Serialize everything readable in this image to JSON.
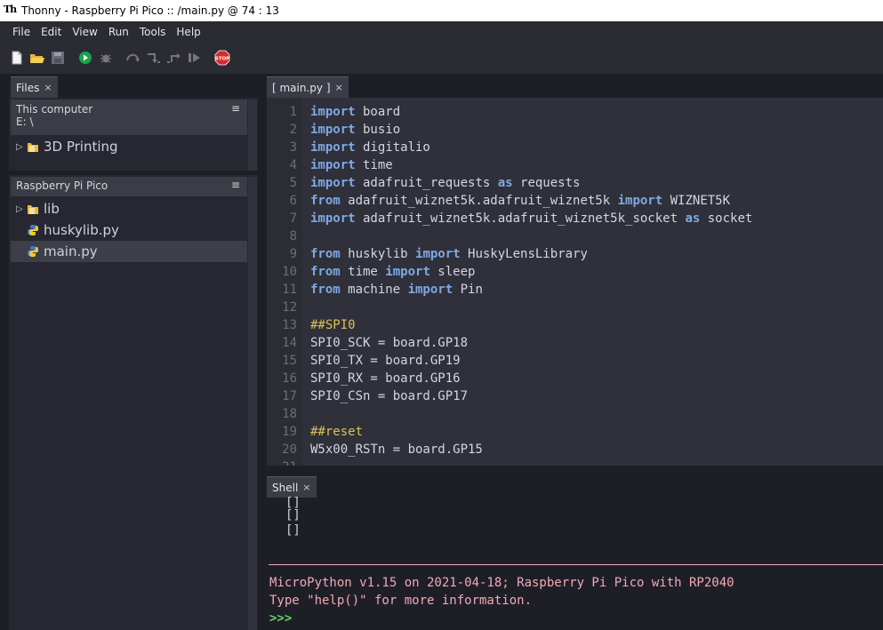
{
  "window": {
    "title": "Thonny  -  Raspberry Pi Pico :: /main.py  @  74 : 13"
  },
  "menu": [
    "File",
    "Edit",
    "View",
    "Run",
    "Tools",
    "Help"
  ],
  "toolbar": {
    "icons": [
      "new-file-icon",
      "open-folder-icon",
      "save-icon",
      "run-icon",
      "debug-icon",
      "step-over-icon",
      "step-into-icon",
      "step-out-icon",
      "resume-icon",
      "stop-icon"
    ],
    "stop_label": "STOP"
  },
  "files_panel": {
    "tab_label": "Files",
    "close": "×",
    "this_computer": {
      "label": "This computer",
      "path": "E: \\",
      "menu": "≡"
    },
    "local_items": [
      {
        "name": "3D Printing",
        "type": "folder"
      }
    ],
    "pico": {
      "label": "Raspberry Pi Pico",
      "menu": "≡",
      "items": [
        {
          "name": "lib",
          "type": "folder"
        },
        {
          "name": "huskylib.py",
          "type": "python"
        },
        {
          "name": "main.py",
          "type": "python",
          "selected": true
        }
      ]
    }
  },
  "editor": {
    "tab_label": "[ main.py ]",
    "close": "×",
    "lines": [
      [
        [
          "kw",
          "import"
        ],
        [
          "t",
          " board"
        ]
      ],
      [
        [
          "kw",
          "import"
        ],
        [
          "t",
          " busio"
        ]
      ],
      [
        [
          "kw",
          "import"
        ],
        [
          "t",
          " digitalio"
        ]
      ],
      [
        [
          "kw",
          "import"
        ],
        [
          "t",
          " time"
        ]
      ],
      [
        [
          "kw",
          "import"
        ],
        [
          "t",
          " adafruit_requests "
        ],
        [
          "kw",
          "as"
        ],
        [
          "t",
          " requests"
        ]
      ],
      [
        [
          "kw",
          "from"
        ],
        [
          "t",
          " adafruit_wiznet5k.adafruit_wiznet5k "
        ],
        [
          "kw",
          "import"
        ],
        [
          "t",
          " WIZNET5K"
        ]
      ],
      [
        [
          "kw",
          "import"
        ],
        [
          "t",
          " adafruit_wiznet5k.adafruit_wiznet5k_socket "
        ],
        [
          "kw",
          "as"
        ],
        [
          "t",
          " socket"
        ]
      ],
      [],
      [
        [
          "kw",
          "from"
        ],
        [
          "t",
          " huskylib "
        ],
        [
          "kw",
          "import"
        ],
        [
          "t",
          " HuskyLensLibrary"
        ]
      ],
      [
        [
          "kw",
          "from"
        ],
        [
          "t",
          " time "
        ],
        [
          "kw",
          "import"
        ],
        [
          "t",
          " sleep"
        ]
      ],
      [
        [
          "kw",
          "from"
        ],
        [
          "t",
          " machine "
        ],
        [
          "kw",
          "import"
        ],
        [
          "t",
          " Pin"
        ]
      ],
      [],
      [
        [
          "cm",
          "##SPI0"
        ]
      ],
      [
        [
          "t",
          "SPI0_SCK = board.GP18"
        ]
      ],
      [
        [
          "t",
          "SPI0_TX = board.GP19"
        ]
      ],
      [
        [
          "t",
          "SPI0_RX = board.GP16"
        ]
      ],
      [
        [
          "t",
          "SPI0_CSn = board.GP17"
        ]
      ],
      [],
      [
        [
          "cm",
          "##reset"
        ]
      ],
      [
        [
          "t",
          "W5x00_RSTn = board.GP15"
        ]
      ],
      [
        [
          "t",
          ""
        ]
      ]
    ]
  },
  "shell": {
    "tab_label": "Shell",
    "close": "×",
    "output_lines": [
      "[]",
      "[]",
      "[]"
    ],
    "banner_line1": "MicroPython v1.15 on 2021-04-18; Raspberry Pi Pico with RP2040",
    "banner_line2": "Type \"help()\" for more information.",
    "prompt": ">>>"
  },
  "colors": {
    "keyword": "#7fa8e6",
    "comment": "#d9c25a",
    "banner": "#f2a8b8",
    "prompt": "#5fd35f"
  }
}
